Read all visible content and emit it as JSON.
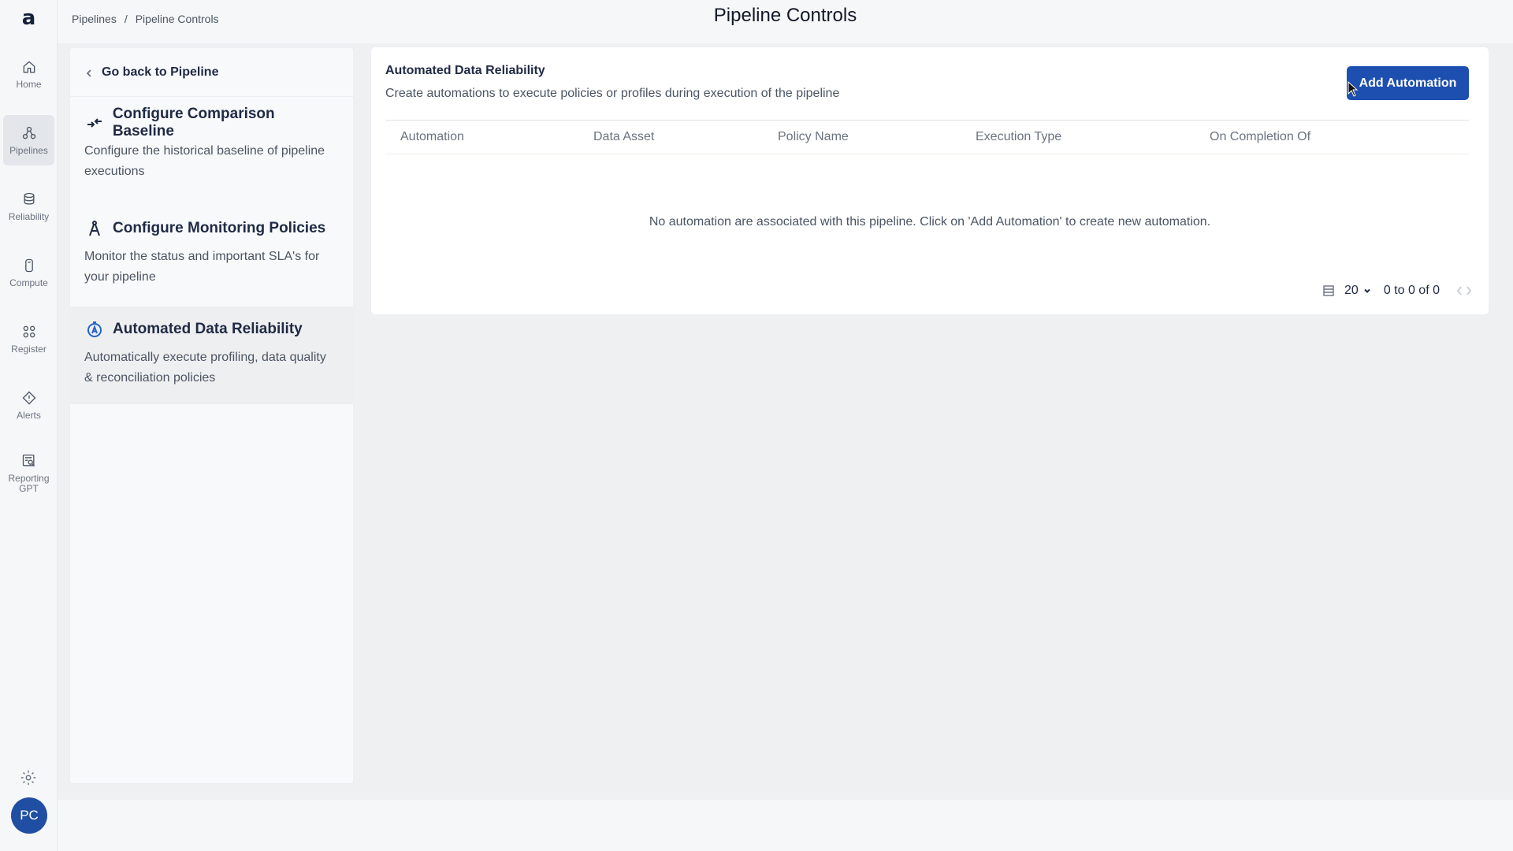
{
  "app": {
    "logo": "a"
  },
  "nav": {
    "items": [
      {
        "label": "Home",
        "icon": "home-icon"
      },
      {
        "label": "Pipelines",
        "icon": "pipelines-icon",
        "active": true
      },
      {
        "label": "Reliability",
        "icon": "reliability-icon"
      },
      {
        "label": "Compute",
        "icon": "compute-icon"
      },
      {
        "label": "Register",
        "icon": "register-icon"
      },
      {
        "label": "Alerts",
        "icon": "alerts-icon"
      },
      {
        "label": "Reporting GPT",
        "icon": "reporting-gpt-icon"
      }
    ],
    "avatar_initials": "PC"
  },
  "header": {
    "breadcrumb": [
      "Pipelines",
      "/",
      "Pipeline Controls"
    ],
    "title": "Pipeline Controls"
  },
  "side_panel": {
    "back_label": "Go back to Pipeline",
    "items": [
      {
        "title": "Configure Comparison Baseline",
        "description": "Configure the historical baseline of pipeline executions",
        "icon": "comparison-arrows-icon"
      },
      {
        "title": "Configure Monitoring Policies",
        "description": "Monitor the status and important SLA's for your pipeline",
        "icon": "compass-icon"
      },
      {
        "title": "Automated Data Reliability",
        "description": "Automatically execute profiling, data quality & reconciliation policies",
        "icon": "automation-timer-icon",
        "active": true
      }
    ]
  },
  "main": {
    "title": "Automated Data Reliability",
    "subtitle": "Create automations to execute policies or profiles during execution of the pipeline",
    "add_button": "Add Automation",
    "columns": [
      "Automation",
      "Data Asset",
      "Policy Name",
      "Execution Type",
      "On Completion Of"
    ],
    "rows": [],
    "empty_message": "No automation are associated with this pipeline. Click on 'Add Automation' to create new automation.",
    "pagination": {
      "page_size": "20",
      "range": "0 to 0 of 0"
    }
  },
  "colors": {
    "accent": "#1d4fb0",
    "avatar": "#1f4ea3",
    "text_dark": "#1f2a44"
  }
}
